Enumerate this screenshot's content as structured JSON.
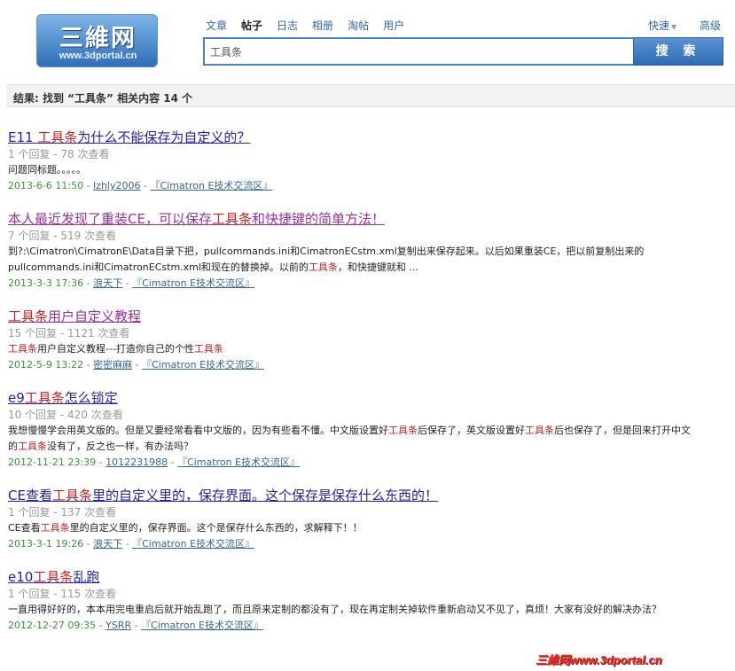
{
  "logo": {
    "main": "三維网",
    "sub": "www.3dportal.cn"
  },
  "tabs": [
    "文章",
    "帖子",
    "日志",
    "相册",
    "淘帖",
    "用户"
  ],
  "quick_label": "快速",
  "advanced_label": "高级",
  "search": {
    "value": "工具条",
    "button_label": "搜 索"
  },
  "result_summary": "结果: 找到 “工具条” 相关内容 14 个",
  "results": [
    {
      "title_parts": [
        "E11 ",
        "工具条",
        "为什么不能保存为自定义的？"
      ],
      "visited": false,
      "meta": "1 个回复 - 78 次查看",
      "snippet_parts": [
        "问题同标题。。。。。"
      ],
      "date": "2013-6-6 11:50",
      "author": "lzhly2006",
      "forum": "『Cimatron E技术交流区』"
    },
    {
      "title_parts": [
        "本人最近发现了重装CE，可以保存",
        "工具条",
        "和快捷键的简单方法！"
      ],
      "visited": true,
      "meta": "7 个回复 - 519 次查看",
      "snippet_parts": [
        "到?:\\Cimatron\\CimatronE\\Data目录下把，pullcommands.ini和CimatronECstm.xml复制出来保存起来。以后如果重装CE，把以前复制出来的pullcommands.ini和CimatronECstm.xml和现在的替换掉。以前的",
        "工具条",
        "，和快捷键就和 ..."
      ],
      "date": "2013-3-3 17:36",
      "author": "浪天下",
      "forum": "『Cimatron E技术交流区』"
    },
    {
      "title_parts": [
        "",
        "工具条",
        "用户自定义教程"
      ],
      "visited": true,
      "meta": "15 个回复 - 1121 次查看",
      "snippet_parts": [
        "",
        "工具条",
        "用户自定义教程---打造你自己的个性",
        "工具条",
        ""
      ],
      "date": "2012-5-9 13:22",
      "author": "密密麻麻",
      "forum": "『Cimatron E技术交流区』"
    },
    {
      "title_parts": [
        "e9",
        "工具条",
        "怎么锁定"
      ],
      "visited": false,
      "meta": "10 个回复 - 420 次查看",
      "snippet_parts": [
        "我想慢慢学会用英文版的。但是又要经常看看中文版的，因为有些看不懂。中文版设置好",
        "工具条",
        "后保存了，英文版设置好",
        "工具条",
        "后也保存了，但是回来打开中文的",
        "工具条",
        "没有了，反之也一样，有办法吗？"
      ],
      "date": "2012-11-21 23:39",
      "author": "1012231988",
      "forum": "『Cimatron E技术交流区』"
    },
    {
      "title_parts": [
        "CE查看",
        "工具条",
        "里的自定义里的，保存界面。这个保存是保存什么东西的！"
      ],
      "visited": false,
      "meta": "1 个回复 - 137 次查看",
      "snippet_parts": [
        "CE查看",
        "工具条",
        "里的自定义里的，保存界面。这个是保存什么东西的，求解释下！！"
      ],
      "date": "2013-3-1 19:26",
      "author": "浪天下",
      "forum": "『Cimatron E技术交流区』"
    },
    {
      "title_parts": [
        "e10",
        "工具条",
        "乱跑"
      ],
      "visited": false,
      "meta": "1 个回复 - 115 次查看",
      "snippet_parts": [
        "一直用得好好的，本本用完电重启后就开始乱跑了，而且原来定制的都没有了，现在再定制关掉软件重新启动又不见了，真烦！大家有没好的解决办法？"
      ],
      "date": "2012-12-27 09:35",
      "author": "YSRR",
      "forum": "『Cimatron E技术交流区』"
    }
  ],
  "watermark": "三維网www.3dportal.cn",
  "colors": {
    "accent": "#3366aa",
    "highlight": "#cc2222",
    "date": "#339933",
    "visited": "#993399",
    "link": "#2222aa"
  }
}
